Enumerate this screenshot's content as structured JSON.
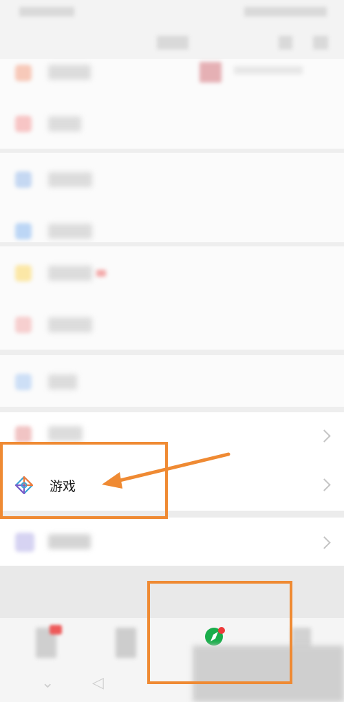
{
  "list": {
    "game_label": "游戏"
  },
  "icons": {
    "game": "game-diamond-icon",
    "discover": "discover-compass-icon",
    "chevron": "chevron-right-icon"
  },
  "colors": {
    "highlight": "#ef8a33",
    "discover_green": "#1aad4b",
    "badge_red": "#ee3a3a"
  }
}
